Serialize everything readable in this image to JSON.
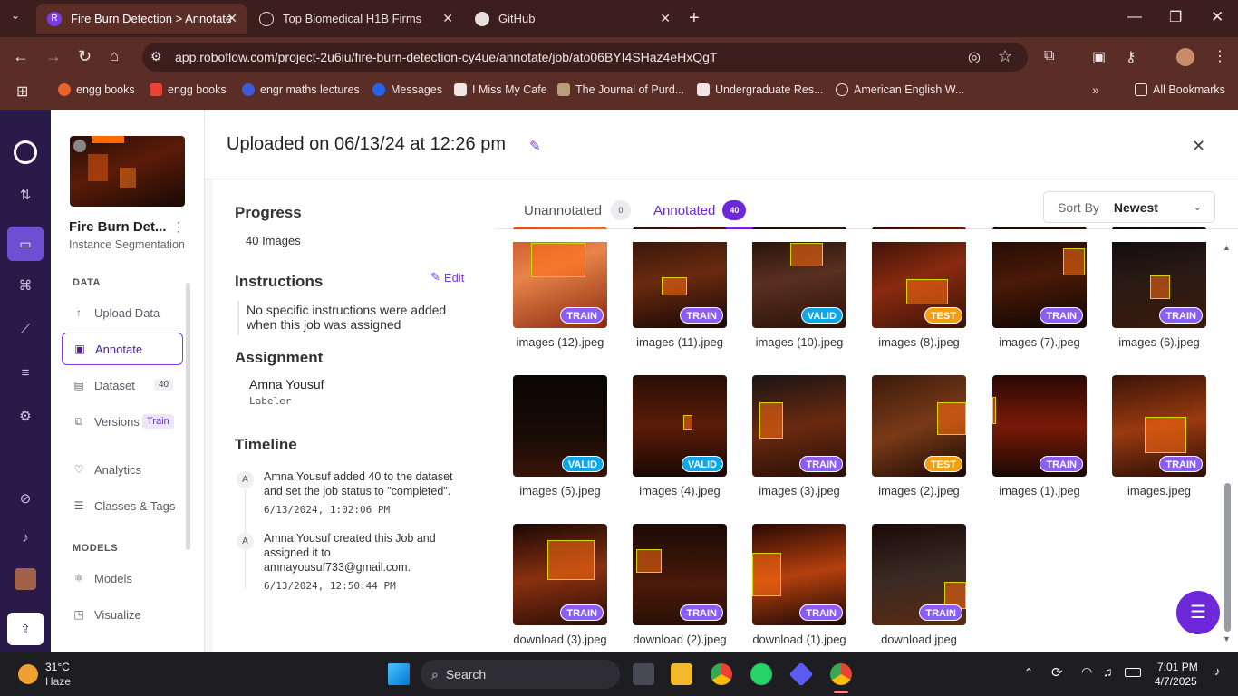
{
  "browser": {
    "tabs": [
      {
        "title": "Fire Burn Detection > Annotate",
        "icon": "roboflow-icon"
      },
      {
        "title": "Top Biomedical H1B Firms",
        "icon": "web-icon"
      },
      {
        "title": "GitHub",
        "icon": "github-icon"
      }
    ],
    "url": "app.roboflow.com/project-2u6iu/fire-burn-detection-cy4ue/annotate/job/ato06BYI4SHaz4eHxQgT",
    "bookmarks": [
      "engg books",
      "engg books",
      "engr maths lectures",
      "Messages",
      "I Miss My Cafe",
      "The Journal of Purd...",
      "Undergraduate Res...",
      "American English W..."
    ],
    "all_bookmarks": "All Bookmarks"
  },
  "project": {
    "name": "Fire Burn Det...",
    "type": "Instance Segmentation"
  },
  "sidebar": {
    "data_section": "DATA",
    "models_section": "MODELS",
    "items": [
      {
        "label": "Upload Data"
      },
      {
        "label": "Annotate"
      },
      {
        "label": "Dataset",
        "badge": "40"
      },
      {
        "label": "Versions",
        "badge": "Train"
      },
      {
        "label": "Analytics"
      },
      {
        "label": "Classes & Tags"
      },
      {
        "label": "Models"
      },
      {
        "label": "Visualize"
      }
    ]
  },
  "header": {
    "title": "Uploaded on 06/13/24 at 12:26 pm"
  },
  "progress": {
    "heading": "Progress",
    "count": "40 Images"
  },
  "instructions": {
    "heading": "Instructions",
    "edit_label": "Edit",
    "text": "No specific instructions were added when this job was assigned"
  },
  "assignment": {
    "heading": "Assignment",
    "name": "Amna Yousuf",
    "role": "Labeler"
  },
  "timeline": {
    "heading": "Timeline",
    "events": [
      {
        "avatar": "A",
        "text": "Amna Yousuf added 40 to the dataset and set the job status to \"completed\".",
        "time": "6/13/2024, 1:02:06 PM"
      },
      {
        "avatar": "A",
        "text": "Amna Yousuf created this Job and assigned it to amnayousuf733@gmail.com.",
        "time": "6/13/2024, 12:50:44 PM"
      }
    ]
  },
  "tabs": {
    "unannotated": {
      "label": "Unannotated",
      "count": "0"
    },
    "annotated": {
      "label": "Annotated",
      "count": "40"
    }
  },
  "sort": {
    "label": "Sort By",
    "value": "Newest"
  },
  "images": [
    {
      "name": "images (12).jpeg",
      "split": "TRAIN"
    },
    {
      "name": "images (11).jpeg",
      "split": "TRAIN"
    },
    {
      "name": "images (10).jpeg",
      "split": "VALID"
    },
    {
      "name": "images (8).jpeg",
      "split": "TEST"
    },
    {
      "name": "images (7).jpeg",
      "split": "TRAIN"
    },
    {
      "name": "images (6).jpeg",
      "split": "TRAIN"
    },
    {
      "name": "images (5).jpeg",
      "split": "VALID"
    },
    {
      "name": "images (4).jpeg",
      "split": "VALID"
    },
    {
      "name": "images (3).jpeg",
      "split": "TRAIN"
    },
    {
      "name": "images (2).jpeg",
      "split": "TEST"
    },
    {
      "name": "images (1).jpeg",
      "split": "TRAIN"
    },
    {
      "name": "images.jpeg",
      "split": "TRAIN"
    },
    {
      "name": "download (3).jpeg",
      "split": "TRAIN"
    },
    {
      "name": "download (2).jpeg",
      "split": "TRAIN"
    },
    {
      "name": "download (1).jpeg",
      "split": "TRAIN"
    },
    {
      "name": "download.jpeg",
      "split": "TRAIN"
    }
  ],
  "colors": {
    "accent": "#7c3aed",
    "train": "#8b5cf6",
    "valid": "#0ea5e9",
    "test": "#f59e0b"
  },
  "taskbar": {
    "weather_temp": "31°C",
    "weather_desc": "Haze",
    "search": "Search",
    "time": "7:01 PM",
    "date": "4/7/2025"
  }
}
